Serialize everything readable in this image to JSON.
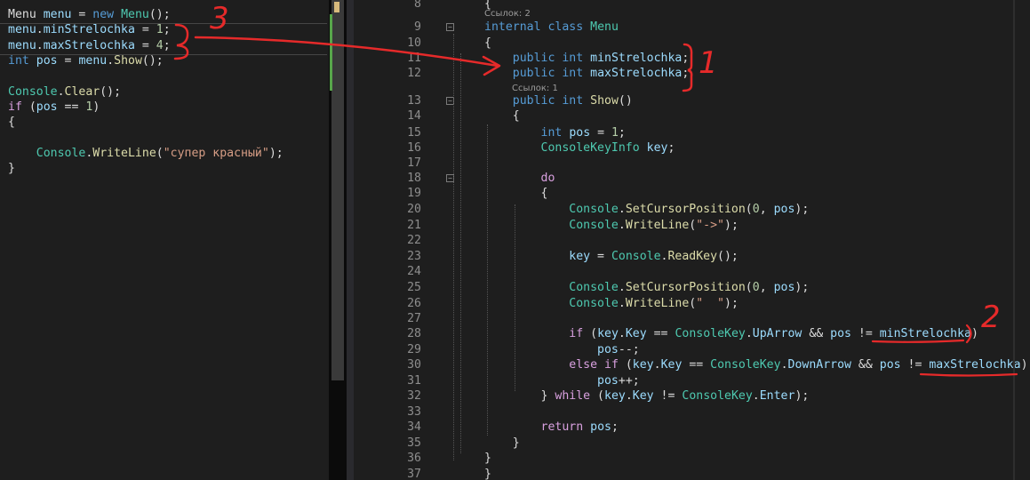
{
  "left_editor": {
    "lines": [
      [
        {
          "t": "Menu ",
          "c": "pl"
        },
        {
          "t": "menu",
          "c": "var"
        },
        {
          "t": " = ",
          "c": "pl"
        },
        {
          "t": "new",
          "c": "kw"
        },
        {
          "t": " ",
          "c": "pl"
        },
        {
          "t": "Menu",
          "c": "typ"
        },
        {
          "t": "();",
          "c": "pl"
        }
      ],
      [
        {
          "t": "menu",
          "c": "var"
        },
        {
          "t": ".",
          "c": "pl"
        },
        {
          "t": "minStrelochka",
          "c": "var"
        },
        {
          "t": " = ",
          "c": "pl"
        },
        {
          "t": "1",
          "c": "num"
        },
        {
          "t": ";",
          "c": "pl"
        }
      ],
      [
        {
          "t": "menu",
          "c": "var"
        },
        {
          "t": ".",
          "c": "pl"
        },
        {
          "t": "maxStrelochka",
          "c": "var"
        },
        {
          "t": " = ",
          "c": "pl"
        },
        {
          "t": "4",
          "c": "num"
        },
        {
          "t": ";",
          "c": "pl"
        }
      ],
      [
        {
          "t": "int",
          "c": "kw"
        },
        {
          "t": " ",
          "c": "pl"
        },
        {
          "t": "pos",
          "c": "var"
        },
        {
          "t": " = ",
          "c": "pl"
        },
        {
          "t": "menu",
          "c": "var"
        },
        {
          "t": ".",
          "c": "pl"
        },
        {
          "t": "Show",
          "c": "mth"
        },
        {
          "t": "();",
          "c": "pl"
        }
      ],
      [],
      [
        {
          "t": "Console",
          "c": "typ"
        },
        {
          "t": ".",
          "c": "pl"
        },
        {
          "t": "Clear",
          "c": "mth"
        },
        {
          "t": "();",
          "c": "pl"
        }
      ],
      [
        {
          "t": "if",
          "c": "ctl"
        },
        {
          "t": " (",
          "c": "pl"
        },
        {
          "t": "pos",
          "c": "var"
        },
        {
          "t": " == ",
          "c": "pl"
        },
        {
          "t": "1",
          "c": "num"
        },
        {
          "t": ")",
          "c": "pl"
        }
      ],
      [
        {
          "t": "{",
          "c": "pl"
        }
      ],
      [],
      [
        {
          "t": "    ",
          "c": "pl"
        },
        {
          "t": "Console",
          "c": "typ"
        },
        {
          "t": ".",
          "c": "pl"
        },
        {
          "t": "WriteLine",
          "c": "mth"
        },
        {
          "t": "(",
          "c": "pl"
        },
        {
          "t": "\"супер красный\"",
          "c": "str"
        },
        {
          "t": ");",
          "c": "pl"
        }
      ],
      [
        {
          "t": "}",
          "c": "pl"
        }
      ]
    ]
  },
  "right_editor": {
    "codelens_refs_class": "Ссылок: 2",
    "codelens_refs_show": "Ссылок: 1",
    "lines": [
      {
        "n": "8",
        "tokens": [
          {
            "t": "{",
            "c": "pl"
          }
        ]
      },
      {
        "n": "9",
        "tokens": [
          {
            "t": "internal",
            "c": "kw"
          },
          {
            "t": " ",
            "c": "pl"
          },
          {
            "t": "class",
            "c": "kw"
          },
          {
            "t": " ",
            "c": "pl"
          },
          {
            "t": "Menu",
            "c": "typ"
          }
        ]
      },
      {
        "n": "10",
        "tokens": [
          {
            "t": "{",
            "c": "pl"
          }
        ]
      },
      {
        "n": "11",
        "tokens": [
          {
            "t": "    ",
            "c": "pl"
          },
          {
            "t": "public",
            "c": "kw"
          },
          {
            "t": " ",
            "c": "pl"
          },
          {
            "t": "int",
            "c": "kw"
          },
          {
            "t": " ",
            "c": "pl"
          },
          {
            "t": "minStrelochka",
            "c": "var"
          },
          {
            "t": ";",
            "c": "pl"
          }
        ]
      },
      {
        "n": "12",
        "tokens": [
          {
            "t": "    ",
            "c": "pl"
          },
          {
            "t": "public",
            "c": "kw"
          },
          {
            "t": " ",
            "c": "pl"
          },
          {
            "t": "int",
            "c": "kw"
          },
          {
            "t": " ",
            "c": "pl"
          },
          {
            "t": "maxStrelochka",
            "c": "var"
          },
          {
            "t": ";",
            "c": "pl"
          }
        ]
      },
      {
        "n": "13",
        "tokens": [
          {
            "t": "    ",
            "c": "pl"
          },
          {
            "t": "public",
            "c": "kw"
          },
          {
            "t": " ",
            "c": "pl"
          },
          {
            "t": "int",
            "c": "kw"
          },
          {
            "t": " ",
            "c": "pl"
          },
          {
            "t": "Show",
            "c": "mth"
          },
          {
            "t": "()",
            "c": "pl"
          }
        ]
      },
      {
        "n": "14",
        "tokens": [
          {
            "t": "    {",
            "c": "pl"
          }
        ]
      },
      {
        "n": "15",
        "tokens": [
          {
            "t": "        ",
            "c": "pl"
          },
          {
            "t": "int",
            "c": "kw"
          },
          {
            "t": " ",
            "c": "pl"
          },
          {
            "t": "pos",
            "c": "var"
          },
          {
            "t": " = ",
            "c": "pl"
          },
          {
            "t": "1",
            "c": "num"
          },
          {
            "t": ";",
            "c": "pl"
          }
        ]
      },
      {
        "n": "16",
        "tokens": [
          {
            "t": "        ",
            "c": "pl"
          },
          {
            "t": "ConsoleKeyInfo",
            "c": "typ"
          },
          {
            "t": " ",
            "c": "pl"
          },
          {
            "t": "key",
            "c": "var"
          },
          {
            "t": ";",
            "c": "pl"
          }
        ]
      },
      {
        "n": "17",
        "tokens": []
      },
      {
        "n": "18",
        "tokens": [
          {
            "t": "        ",
            "c": "pl"
          },
          {
            "t": "do",
            "c": "ctl"
          }
        ]
      },
      {
        "n": "19",
        "tokens": [
          {
            "t": "        {",
            "c": "pl"
          }
        ]
      },
      {
        "n": "20",
        "tokens": [
          {
            "t": "            ",
            "c": "pl"
          },
          {
            "t": "Console",
            "c": "typ"
          },
          {
            "t": ".",
            "c": "pl"
          },
          {
            "t": "SetCursorPosition",
            "c": "mth"
          },
          {
            "t": "(",
            "c": "pl"
          },
          {
            "t": "0",
            "c": "num"
          },
          {
            "t": ", ",
            "c": "pl"
          },
          {
            "t": "pos",
            "c": "var"
          },
          {
            "t": ");",
            "c": "pl"
          }
        ]
      },
      {
        "n": "21",
        "tokens": [
          {
            "t": "            ",
            "c": "pl"
          },
          {
            "t": "Console",
            "c": "typ"
          },
          {
            "t": ".",
            "c": "pl"
          },
          {
            "t": "WriteLine",
            "c": "mth"
          },
          {
            "t": "(",
            "c": "pl"
          },
          {
            "t": "\"->\"",
            "c": "str"
          },
          {
            "t": ");",
            "c": "pl"
          }
        ]
      },
      {
        "n": "22",
        "tokens": []
      },
      {
        "n": "23",
        "tokens": [
          {
            "t": "            ",
            "c": "pl"
          },
          {
            "t": "key",
            "c": "var"
          },
          {
            "t": " = ",
            "c": "pl"
          },
          {
            "t": "Console",
            "c": "typ"
          },
          {
            "t": ".",
            "c": "pl"
          },
          {
            "t": "ReadKey",
            "c": "mth"
          },
          {
            "t": "();",
            "c": "pl"
          }
        ]
      },
      {
        "n": "24",
        "tokens": []
      },
      {
        "n": "25",
        "tokens": [
          {
            "t": "            ",
            "c": "pl"
          },
          {
            "t": "Console",
            "c": "typ"
          },
          {
            "t": ".",
            "c": "pl"
          },
          {
            "t": "SetCursorPosition",
            "c": "mth"
          },
          {
            "t": "(",
            "c": "pl"
          },
          {
            "t": "0",
            "c": "num"
          },
          {
            "t": ", ",
            "c": "pl"
          },
          {
            "t": "pos",
            "c": "var"
          },
          {
            "t": ");",
            "c": "pl"
          }
        ]
      },
      {
        "n": "26",
        "tokens": [
          {
            "t": "            ",
            "c": "pl"
          },
          {
            "t": "Console",
            "c": "typ"
          },
          {
            "t": ".",
            "c": "pl"
          },
          {
            "t": "WriteLine",
            "c": "mth"
          },
          {
            "t": "(",
            "c": "pl"
          },
          {
            "t": "\"  \"",
            "c": "str"
          },
          {
            "t": ");",
            "c": "pl"
          }
        ]
      },
      {
        "n": "27",
        "tokens": []
      },
      {
        "n": "28",
        "tokens": [
          {
            "t": "            ",
            "c": "pl"
          },
          {
            "t": "if",
            "c": "ctl"
          },
          {
            "t": " (",
            "c": "pl"
          },
          {
            "t": "key",
            "c": "var"
          },
          {
            "t": ".",
            "c": "pl"
          },
          {
            "t": "Key",
            "c": "var"
          },
          {
            "t": " == ",
            "c": "pl"
          },
          {
            "t": "ConsoleKey",
            "c": "typ"
          },
          {
            "t": ".",
            "c": "pl"
          },
          {
            "t": "UpArrow",
            "c": "var"
          },
          {
            "t": " && ",
            "c": "pl"
          },
          {
            "t": "pos",
            "c": "var"
          },
          {
            "t": " != ",
            "c": "pl"
          },
          {
            "t": "minStrelochka",
            "c": "var"
          },
          {
            "t": ")",
            "c": "pl"
          }
        ]
      },
      {
        "n": "29",
        "tokens": [
          {
            "t": "                ",
            "c": "pl"
          },
          {
            "t": "pos",
            "c": "var"
          },
          {
            "t": "--;",
            "c": "pl"
          }
        ]
      },
      {
        "n": "30",
        "tokens": [
          {
            "t": "            ",
            "c": "pl"
          },
          {
            "t": "else",
            "c": "ctl"
          },
          {
            "t": " ",
            "c": "pl"
          },
          {
            "t": "if",
            "c": "ctl"
          },
          {
            "t": " (",
            "c": "pl"
          },
          {
            "t": "key",
            "c": "var"
          },
          {
            "t": ".",
            "c": "pl"
          },
          {
            "t": "Key",
            "c": "var"
          },
          {
            "t": " == ",
            "c": "pl"
          },
          {
            "t": "ConsoleKey",
            "c": "typ"
          },
          {
            "t": ".",
            "c": "pl"
          },
          {
            "t": "DownArrow",
            "c": "var"
          },
          {
            "t": " && ",
            "c": "pl"
          },
          {
            "t": "pos",
            "c": "var"
          },
          {
            "t": " != ",
            "c": "pl"
          },
          {
            "t": "maxStrelochka",
            "c": "var"
          },
          {
            "t": ")",
            "c": "pl"
          }
        ]
      },
      {
        "n": "31",
        "tokens": [
          {
            "t": "                ",
            "c": "pl"
          },
          {
            "t": "pos",
            "c": "var"
          },
          {
            "t": "++;",
            "c": "pl"
          }
        ]
      },
      {
        "n": "32",
        "tokens": [
          {
            "t": "        } ",
            "c": "pl"
          },
          {
            "t": "while",
            "c": "ctl"
          },
          {
            "t": " (",
            "c": "pl"
          },
          {
            "t": "key",
            "c": "var"
          },
          {
            "t": ".",
            "c": "pl"
          },
          {
            "t": "Key",
            "c": "var"
          },
          {
            "t": " != ",
            "c": "pl"
          },
          {
            "t": "ConsoleKey",
            "c": "typ"
          },
          {
            "t": ".",
            "c": "pl"
          },
          {
            "t": "Enter",
            "c": "var"
          },
          {
            "t": ");",
            "c": "pl"
          }
        ]
      },
      {
        "n": "33",
        "tokens": []
      },
      {
        "n": "34",
        "tokens": [
          {
            "t": "        ",
            "c": "pl"
          },
          {
            "t": "return",
            "c": "ctl"
          },
          {
            "t": " ",
            "c": "pl"
          },
          {
            "t": "pos",
            "c": "var"
          },
          {
            "t": ";",
            "c": "pl"
          }
        ]
      },
      {
        "n": "35",
        "tokens": [
          {
            "t": "    }",
            "c": "pl"
          }
        ]
      },
      {
        "n": "36",
        "tokens": [
          {
            "t": "}",
            "c": "pl"
          }
        ]
      },
      {
        "n": "37",
        "tokens": [
          {
            "t": "}",
            "c": "pl"
          }
        ]
      }
    ]
  },
  "annotations": {
    "label_1": "1",
    "label_2": "2",
    "label_3": "3",
    "color": "#e62a2a"
  },
  "colors": {
    "background": "#1e1e1e",
    "keyword": "#569cd6",
    "control": "#d8a0df",
    "type": "#4ec9b0",
    "method": "#dcdcaa",
    "variable": "#9cdcfe",
    "number": "#b5cea8",
    "string": "#d69d85"
  }
}
